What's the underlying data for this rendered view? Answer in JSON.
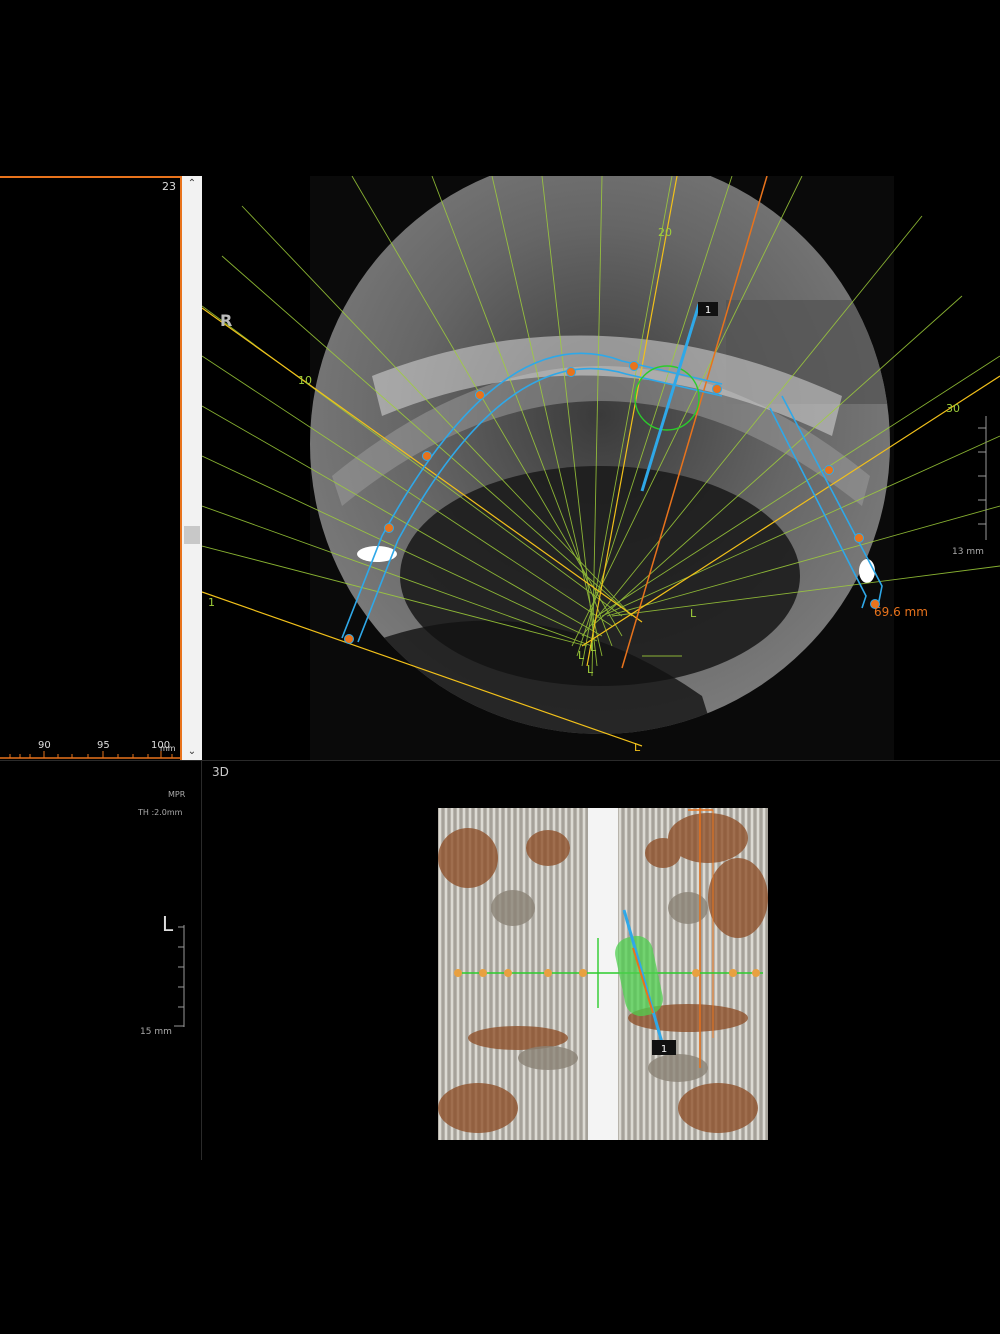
{
  "panoramic_panel": {
    "slice_number": "23",
    "ruler_ticks": [
      "90",
      "95",
      "100"
    ],
    "ruler_unit": "mm"
  },
  "scrollbar": {
    "up_glyph": "⌃",
    "down_glyph": "⌄"
  },
  "axial_view": {
    "orientation_label": "R",
    "curve_numbers": [
      "1",
      "10",
      "20",
      "30"
    ],
    "lingual_markers": [
      "L",
      "L",
      "L",
      "L",
      "L"
    ],
    "scale_label": "13 mm",
    "measurement_label": "69.6 mm",
    "implant_id": "1"
  },
  "view3d": {
    "label": "3D",
    "implant_id": "1"
  },
  "cross_section_panel": {
    "mode_label": "MPR",
    "thickness_label": "TH :2.0mm",
    "orientation_label": "L",
    "scale_label": "15 mm"
  },
  "colors": {
    "accent_orange": "#e8731c",
    "curve_blue": "#2fa8e8",
    "section_green": "#9fcf3a",
    "implant_green": "#4fd04f"
  }
}
